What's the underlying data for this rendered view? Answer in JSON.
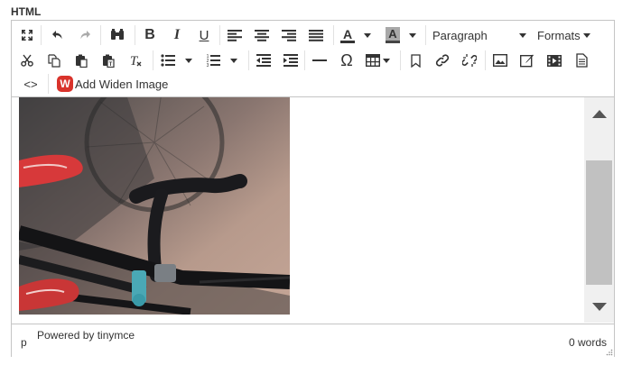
{
  "field_label": "HTML",
  "toolbar": {
    "row1": [
      {
        "name": "fullscreen-icon"
      },
      {
        "name": "undo-icon"
      },
      {
        "name": "redo-icon"
      },
      {
        "name": "find-replace-icon"
      },
      {
        "name": "bold-icon",
        "glyph": "B"
      },
      {
        "name": "italic-icon",
        "glyph": "I"
      },
      {
        "name": "underline-icon",
        "glyph": "U"
      },
      {
        "name": "align-left-icon"
      },
      {
        "name": "align-center-icon"
      },
      {
        "name": "align-right-icon"
      },
      {
        "name": "align-justify-icon"
      },
      {
        "name": "text-color-icon",
        "glyph": "A"
      },
      {
        "name": "background-color-icon",
        "glyph": "A"
      }
    ],
    "block_format": "Paragraph",
    "formats": "Formats",
    "row2": [
      {
        "name": "cut-icon"
      },
      {
        "name": "copy-icon"
      },
      {
        "name": "paste-icon"
      },
      {
        "name": "paste-text-icon"
      },
      {
        "name": "clear-formatting-icon"
      },
      {
        "name": "bullet-list-icon"
      },
      {
        "name": "numbered-list-icon"
      },
      {
        "name": "outdent-icon"
      },
      {
        "name": "indent-icon"
      },
      {
        "name": "horizontal-rule-icon"
      },
      {
        "name": "special-character-icon",
        "glyph": "Ω"
      },
      {
        "name": "table-icon"
      },
      {
        "name": "anchor-icon"
      },
      {
        "name": "link-icon"
      },
      {
        "name": "unlink-icon"
      },
      {
        "name": "image-icon"
      },
      {
        "name": "edit-image-icon"
      },
      {
        "name": "media-icon"
      },
      {
        "name": "preview-icon"
      }
    ],
    "source_code_glyph": "<>",
    "widen_label": "Add Widen Image",
    "widen_logo_letter": "W"
  },
  "statusbar": {
    "path": "p",
    "powered_by": "Powered by tinymce",
    "word_count": "0 words"
  },
  "colors": {
    "border": "#c5c5c5",
    "widen_red": "#d9332b",
    "scroll_thumb": "#c1c1c1",
    "scroll_track": "#f0f0f0"
  }
}
